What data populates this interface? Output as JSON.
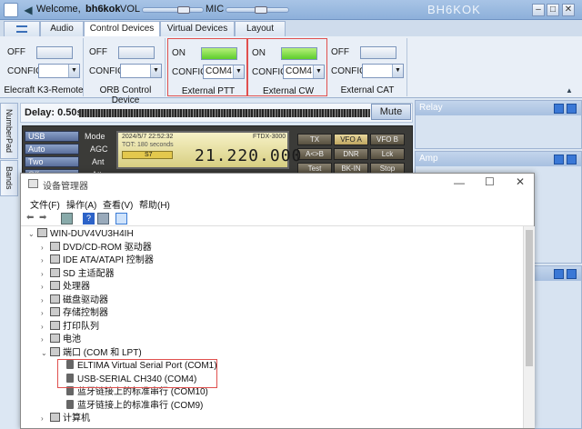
{
  "titlebar": {
    "welcome": "Welcome,",
    "user": "bh6kok",
    "vol_label": "VOL",
    "mic_label": "MIC",
    "app_name": "BH6KOK",
    "min_icon": "minimize-icon",
    "max_icon": "maximize-icon",
    "close_icon": "close-icon",
    "vol_level": 0.7,
    "mic_level": 0.55
  },
  "tabs": [
    "",
    "Audio",
    "Control Devices",
    "Virtual Devices",
    "Layout"
  ],
  "active_tab": "Control Devices",
  "devices": [
    {
      "state": "OFF",
      "config": "CONFIG",
      "port": "",
      "label": "Elecraft K3-Remote",
      "on": false
    },
    {
      "state": "OFF",
      "config": "CONFIG",
      "port": "",
      "label": "ORB Control Device",
      "on": false
    },
    {
      "state": "ON",
      "config": "CONFIG",
      "port": "COM4",
      "label": "External PTT",
      "on": true
    },
    {
      "state": "ON",
      "config": "CONFIG",
      "port": "COM4",
      "label": "External CW",
      "on": true
    },
    {
      "state": "OFF",
      "config": "CONFIG",
      "port": "",
      "label": "External CAT",
      "on": false
    }
  ],
  "side_tabs": [
    "NumberPad",
    "Bands"
  ],
  "delay": {
    "label": "Delay: 0.50s",
    "mute": "Mute"
  },
  "radio": {
    "buttons": [
      "USB",
      "Auto",
      "Two",
      "Off"
    ],
    "labels": [
      "Mode",
      "AGC",
      "Ant",
      "Att"
    ],
    "datetime": "2024/5/7 22:52:32",
    "model": "FTDX-3000",
    "tot": "TOT: 180 seconds",
    "smeter": "S7",
    "frequency": "21.220.000",
    "func_buttons": [
      "TX",
      "VFO A",
      "VFO B",
      "A<>B",
      "DNR",
      "Lck",
      "Test",
      "BK-IN",
      "Stop"
    ]
  },
  "right_panels": {
    "relay": "Relay",
    "amp": "Amp"
  },
  "device_manager": {
    "title": "设备管理器",
    "menu": [
      "文件(F)",
      "操作(A)",
      "查看(V)",
      "帮助(H)"
    ],
    "root": "WIN-DUV4VU3H4IH",
    "categories": [
      "DVD/CD-ROM 驱动器",
      "IDE ATA/ATAPI 控制器",
      "SD 主适配器",
      "处理器",
      "磁盘驱动器",
      "存储控制器",
      "打印队列",
      "电池",
      "端口 (COM 和 LPT)"
    ],
    "ports": [
      "ELTIMA Virtual Serial Port (COM1)",
      "USB-SERIAL CH340 (COM4)",
      "蓝牙链接上的标准串行 (COM10)",
      "蓝牙链接上的标准串行 (COM9)"
    ],
    "last": "计算机"
  }
}
